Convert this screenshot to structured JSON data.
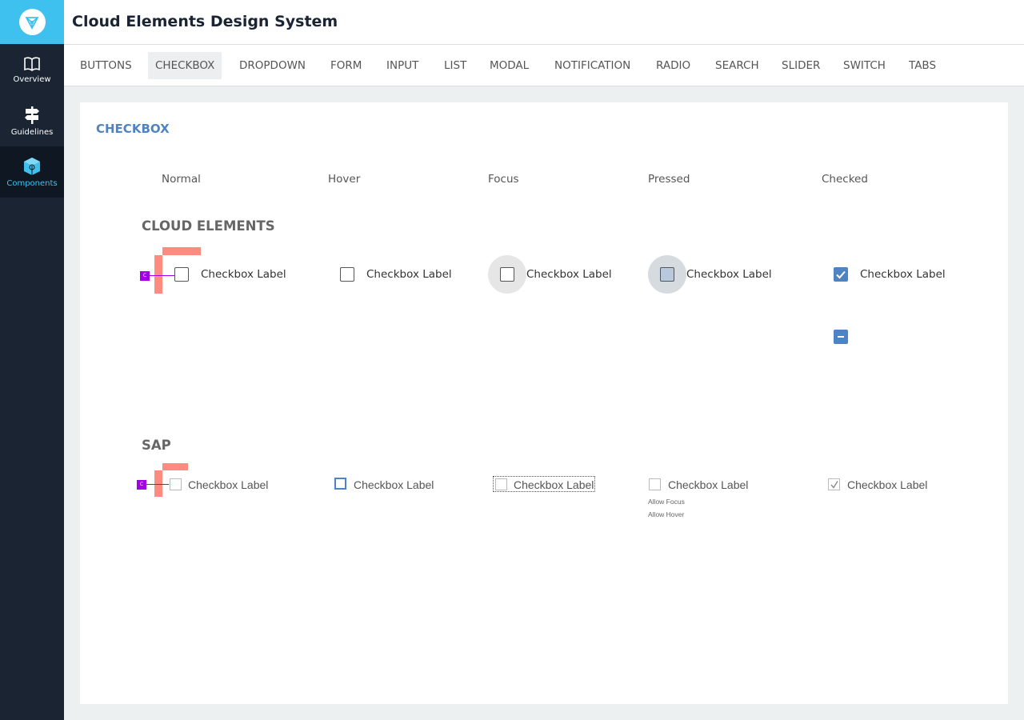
{
  "app": {
    "title": "Cloud Elements Design System"
  },
  "sidebar": {
    "items": [
      {
        "label": "Overview",
        "icon": "book-icon"
      },
      {
        "label": "Guidelines",
        "icon": "signpost-icon"
      },
      {
        "label": "Components",
        "icon": "cube-icon",
        "active": true
      }
    ]
  },
  "tabs": [
    {
      "label": "BUTTONS"
    },
    {
      "label": "CHECKBOX",
      "active": true
    },
    {
      "label": "DROPDOWN"
    },
    {
      "label": "FORM"
    },
    {
      "label": "INPUT"
    },
    {
      "label": "LIST"
    },
    {
      "label": "MODAL"
    },
    {
      "label": "NOTIFICATION"
    },
    {
      "label": "RADIO"
    },
    {
      "label": "SEARCH"
    },
    {
      "label": "SLIDER"
    },
    {
      "label": "SWITCH"
    },
    {
      "label": "TABS"
    }
  ],
  "content": {
    "section_title": "CHECKBOX",
    "columns": [
      "Normal",
      "Hover",
      "Focus",
      "Pressed",
      "Checked"
    ],
    "cloud_elements": {
      "title": "CLOUD ELEMENTS",
      "checkbox_label": "Checkbox Label"
    },
    "sap": {
      "title": "SAP",
      "checkbox_label": "Checkbox Label",
      "notes": [
        "Allow Focus",
        "Allow Hover"
      ]
    },
    "redline": {
      "marker": "C"
    }
  },
  "colors": {
    "brand": "#3ec1ef",
    "sidebar_bg": "#1a2433",
    "accent_blue": "#4f84c4",
    "redline": "#ff8a80",
    "marker_purple": "#a100e6"
  }
}
